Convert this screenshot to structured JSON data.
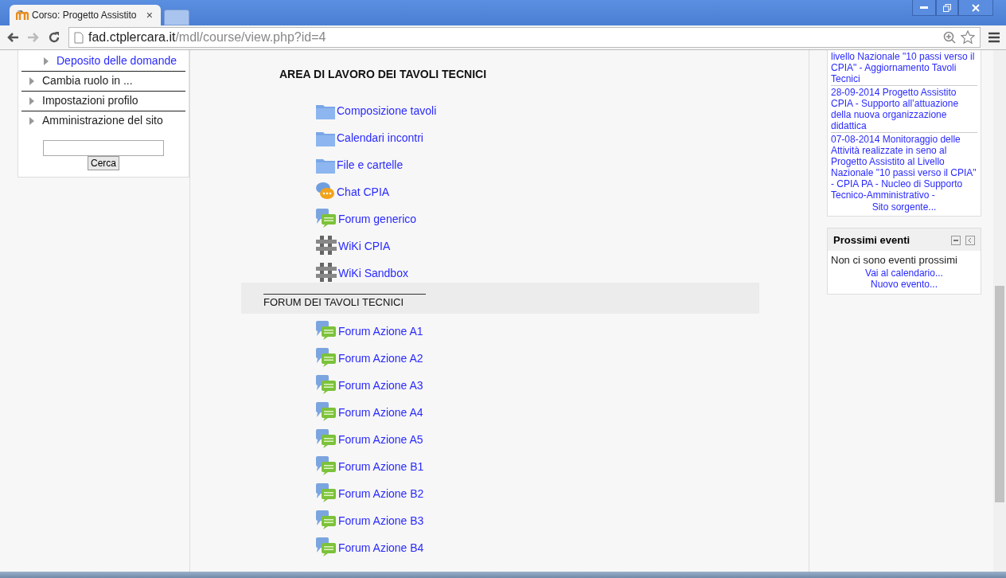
{
  "browser": {
    "tab": {
      "title": "Corso: Progetto Assistito",
      "close": "×"
    },
    "url": {
      "host": "fad.ctplercara.it",
      "path": "/mdl/course/view.php?id=4"
    }
  },
  "left_block": {
    "items": [
      {
        "kind": "link",
        "label": "Deposito delle domande"
      },
      {
        "kind": "node",
        "label": "Cambia ruolo in ..."
      },
      {
        "kind": "node",
        "label": "Impostazioni profilo"
      },
      {
        "kind": "node",
        "label": "Amministrazione del sito"
      }
    ],
    "search": {
      "button": "Cerca"
    }
  },
  "main": {
    "sections": [
      {
        "title": "AREA DI LAVORO DEI TAVOLI TECNICI",
        "highlighted": false,
        "activities": [
          {
            "kind": "folder",
            "label": "Composizione tavoli"
          },
          {
            "kind": "folder",
            "label": "Calendari incontri"
          },
          {
            "kind": "folder",
            "label": "File e cartelle"
          },
          {
            "kind": "chat",
            "label": "Chat CPIA"
          },
          {
            "kind": "forum",
            "label": "Forum generico"
          },
          {
            "kind": "wiki",
            "label": "WiKi CPIA"
          },
          {
            "kind": "wiki",
            "label": "WiKi Sandbox"
          }
        ]
      },
      {
        "title": "FORUM DEI TAVOLI TECNICI",
        "highlighted": true,
        "activities": [
          {
            "kind": "forum",
            "label": "Forum Azione A1"
          },
          {
            "kind": "forum",
            "label": "Forum Azione A2"
          },
          {
            "kind": "forum",
            "label": "Forum Azione A3"
          },
          {
            "kind": "forum",
            "label": "Forum Azione A4"
          },
          {
            "kind": "forum",
            "label": "Forum Azione A5"
          },
          {
            "kind": "forum",
            "label": "Forum Azione B1"
          },
          {
            "kind": "forum",
            "label": "Forum Azione B2"
          },
          {
            "kind": "forum",
            "label": "Forum Azione B3"
          },
          {
            "kind": "forum",
            "label": "Forum Azione B4"
          }
        ]
      }
    ]
  },
  "right": {
    "news": {
      "items": [
        "livello Nazionale \"10 passi verso il CPIA\" - Aggiornamento Tavoli Tecnici",
        "28-09-2014 Progetto Assistito CPIA - Supporto all’attuazione della nuova organizzazione didattica",
        "07-08-2014 Monitoraggio delle Attività realizzate in seno al Progetto Assistito al Livello Nazionale \"10 passi verso il CPIA\" - CPIA PA - Nucleo di Supporto Tecnico-Amministrativo -"
      ],
      "footer": "Sito sorgente..."
    },
    "events": {
      "title": "Prossimi eventi",
      "message": "Non ci sono eventi prossimi",
      "links": [
        "Vai al calendario...",
        "Nuovo evento..."
      ]
    }
  }
}
